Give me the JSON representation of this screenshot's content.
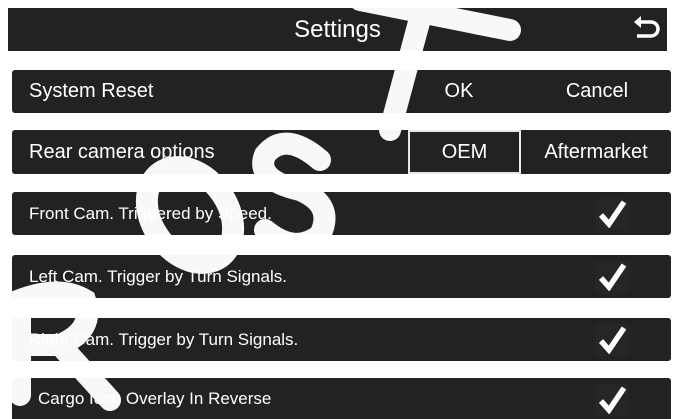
{
  "header": {
    "title": "Settings",
    "back_icon": "return-arrow-icon"
  },
  "system_reset": {
    "label": "System Reset",
    "ok": "OK",
    "cancel": "Cancel"
  },
  "rear_camera": {
    "label": "Rear camera options",
    "options": [
      "OEM",
      "Aftermarket"
    ],
    "selected": "OEM"
  },
  "toggles": [
    {
      "label": "Front Cam. Triggered by Speed.",
      "checked": true
    },
    {
      "label": "Left Cam. Trigger by Turn Signals.",
      "checked": true
    },
    {
      "label": "Right Cam. Trigger by Turn Signals.",
      "checked": true
    },
    {
      "label": "Cargo Icon Overlay In Reverse",
      "checked": true
    }
  ],
  "colors": {
    "bar": "#222222",
    "text": "#ffffff",
    "watermark": "#000000"
  },
  "watermark": {
    "icon": "diagonal-watermark-graphic"
  }
}
